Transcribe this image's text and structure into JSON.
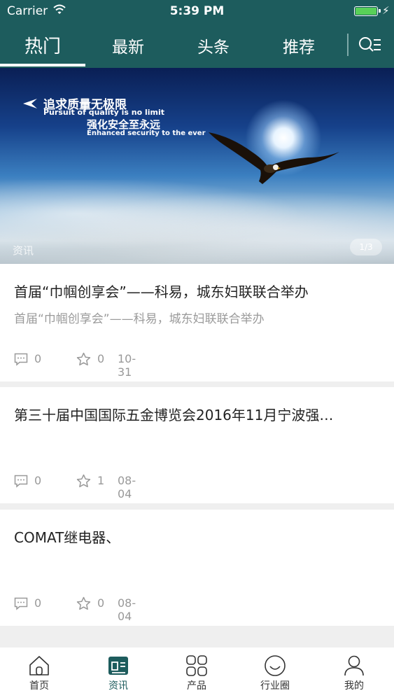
{
  "status": {
    "carrier": "Carrier",
    "time": "5:39 PM"
  },
  "tabs": [
    {
      "label": "热门",
      "active": true
    },
    {
      "label": "最新",
      "active": false
    },
    {
      "label": "头条",
      "active": false
    },
    {
      "label": "推荐",
      "active": false
    }
  ],
  "banner": {
    "headline_cn": "追求质量无极限",
    "headline_en": "Pursuit of quality is no limit",
    "sub_cn": "强化安全至永远",
    "sub_en": "Enhanced security to the ever",
    "label": "资讯",
    "counter": "1/3"
  },
  "articles": [
    {
      "title": "首届“巾帼创享会”——科易，城东妇联联合举办",
      "subtitle": "首届“巾帼创享会”——科易，城东妇联联合举办",
      "comments": "0",
      "stars": "0",
      "date": "10-31"
    },
    {
      "title": "第三十届中国国际五金博览会2016年11月宁波强…",
      "subtitle": "",
      "comments": "0",
      "stars": "1",
      "date": "08-04"
    },
    {
      "title": "COMAT继电器、",
      "subtitle": "",
      "comments": "0",
      "stars": "0",
      "date": "08-04"
    }
  ],
  "bottom_nav": [
    {
      "label": "首页",
      "icon": "home-icon",
      "active": false
    },
    {
      "label": "资讯",
      "icon": "news-icon",
      "active": true
    },
    {
      "label": "产品",
      "icon": "grid-icon",
      "active": false
    },
    {
      "label": "行业圈",
      "icon": "smile-circle-icon",
      "active": false
    },
    {
      "label": "我的",
      "icon": "person-icon",
      "active": false
    }
  ],
  "colors": {
    "accent": "#1d5c5d",
    "battery": "#58d058"
  }
}
